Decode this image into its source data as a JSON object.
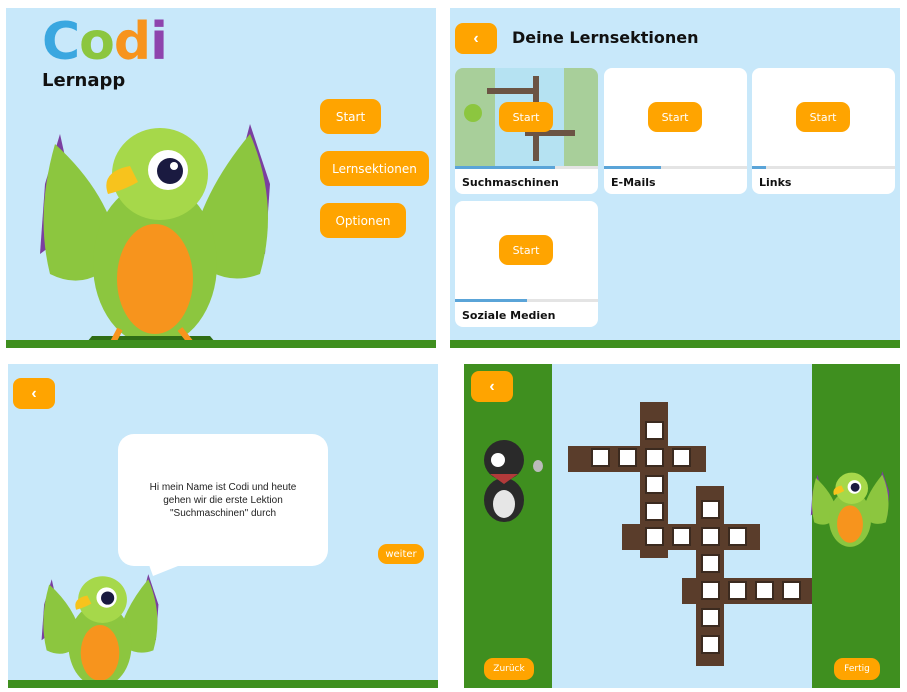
{
  "menu": {
    "logo_letters": [
      "C",
      "o",
      "d",
      "i"
    ],
    "logo_colors": [
      "#3aa7e0",
      "#8cc63f",
      "#f7941d",
      "#8e44ad"
    ],
    "subtitle": "Lernapp",
    "buttons": [
      "Start",
      "Lernsektionen",
      "Optionen"
    ]
  },
  "sections": {
    "back_icon": "‹",
    "title": "Deine Lernsektionen",
    "cards": [
      {
        "label": "Suchmaschinen",
        "button": "Start",
        "progress": 0.7
      },
      {
        "label": "E-Mails",
        "button": "Start",
        "progress": 0.4
      },
      {
        "label": "Links",
        "button": "Start",
        "progress": 0.1
      },
      {
        "label": "Soziale Medien",
        "button": "Start",
        "progress": 0.5
      }
    ]
  },
  "dialog": {
    "back_icon": "‹",
    "text": "Hi mein Name ist Codi und heute\ngehen wir die erste Lektion\n\"Suchmaschinen\" durch",
    "next_label": "weiter"
  },
  "puzzle": {
    "back_icon": "‹",
    "back_label": "Zurück",
    "done_label": "Fertig"
  },
  "colors": {
    "accent": "#ffa400",
    "sky": "#c8e8fa",
    "grass": "#3f8f1f",
    "progress": "#5aa4d8"
  }
}
